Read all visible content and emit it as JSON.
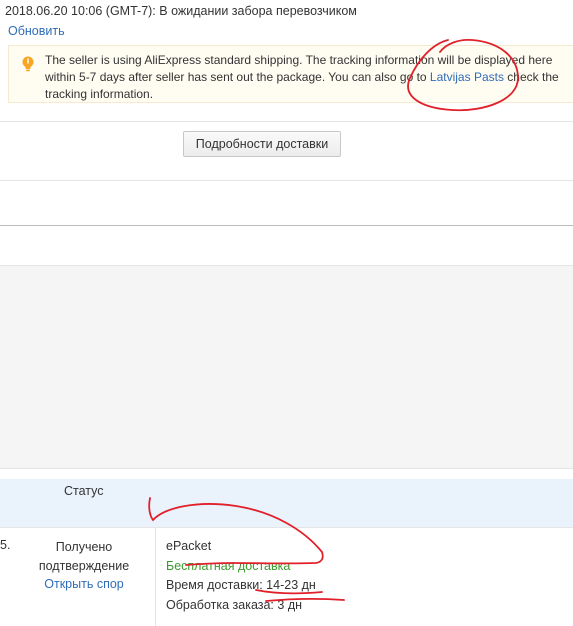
{
  "order_status": {
    "line": "2018.06.20 10:06 (GMT-7): В ожидании забора перевозчиком",
    "refresh_label": "Обновить"
  },
  "notice": {
    "icon": "lightbulb-icon",
    "text_before": "The seller is using AliExpress standard shipping. The tracking information will be displayed here within 5-7 days after seller has sent out the package. You can also go to ",
    "link_text": "Latvijas Pasts",
    "text_after": " check the tracking information."
  },
  "shipping_details_button": "Подробности доставки",
  "table": {
    "header_status": "Статус",
    "row": {
      "number_fragment": "5.",
      "status_line1": "Получено",
      "status_line2": "подтверждение",
      "dispute_link": "Открыть спор",
      "shipping_method": "ePacket",
      "free_shipping": "Бесплатная доставка",
      "delivery_time_label": "Время доставки:",
      "delivery_time_value": "14-23 дн",
      "processing_label": "Обработка заказа:",
      "processing_value": "3 дн"
    }
  },
  "colors": {
    "link": "#2f6db6",
    "free_shipping": "#3a9a2b",
    "annotation": "#e0202a",
    "table_header_bg": "#eaf2fc",
    "notice_bg": "#fffcf2"
  }
}
